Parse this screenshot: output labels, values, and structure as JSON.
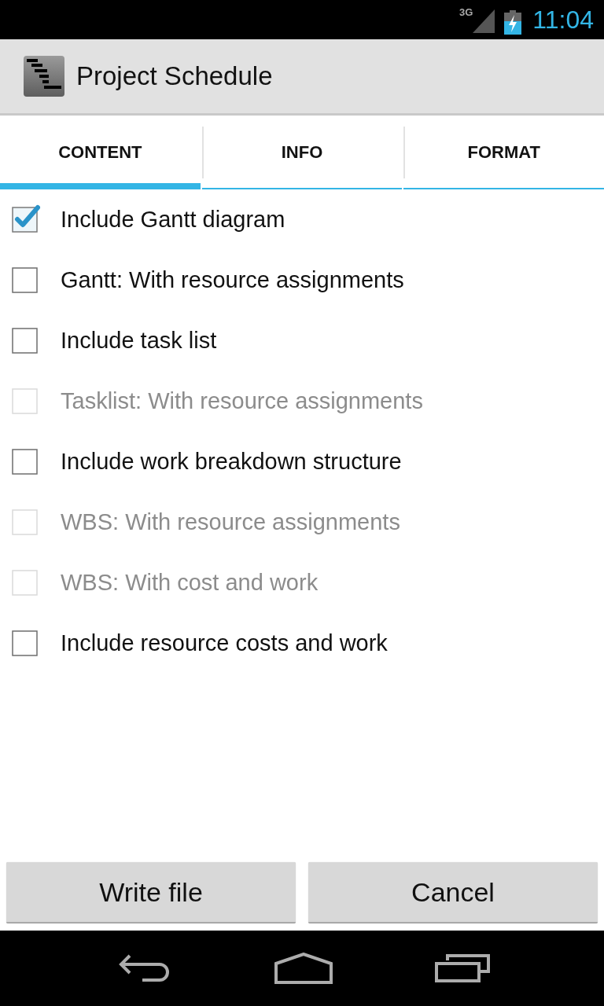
{
  "status_bar": {
    "network": "3G",
    "time": "11:04"
  },
  "action_bar": {
    "title": "Project Schedule"
  },
  "tabs": [
    {
      "label": "CONTENT",
      "selected": true
    },
    {
      "label": "INFO",
      "selected": false
    },
    {
      "label": "FORMAT",
      "selected": false
    }
  ],
  "options": [
    {
      "label": "Include Gantt diagram",
      "checked": true,
      "disabled": false
    },
    {
      "label": "Gantt: With resource assignments",
      "checked": false,
      "disabled": false
    },
    {
      "label": "Include task list",
      "checked": false,
      "disabled": false
    },
    {
      "label": "Tasklist: With resource assignments",
      "checked": false,
      "disabled": true
    },
    {
      "label": "Include work breakdown structure",
      "checked": false,
      "disabled": false
    },
    {
      "label": "WBS: With resource assignments",
      "checked": false,
      "disabled": true
    },
    {
      "label": "WBS: With cost and work",
      "checked": false,
      "disabled": true
    },
    {
      "label": "Include resource costs and work",
      "checked": false,
      "disabled": false
    }
  ],
  "buttons": [
    {
      "label": "Write file"
    },
    {
      "label": "Cancel"
    }
  ]
}
